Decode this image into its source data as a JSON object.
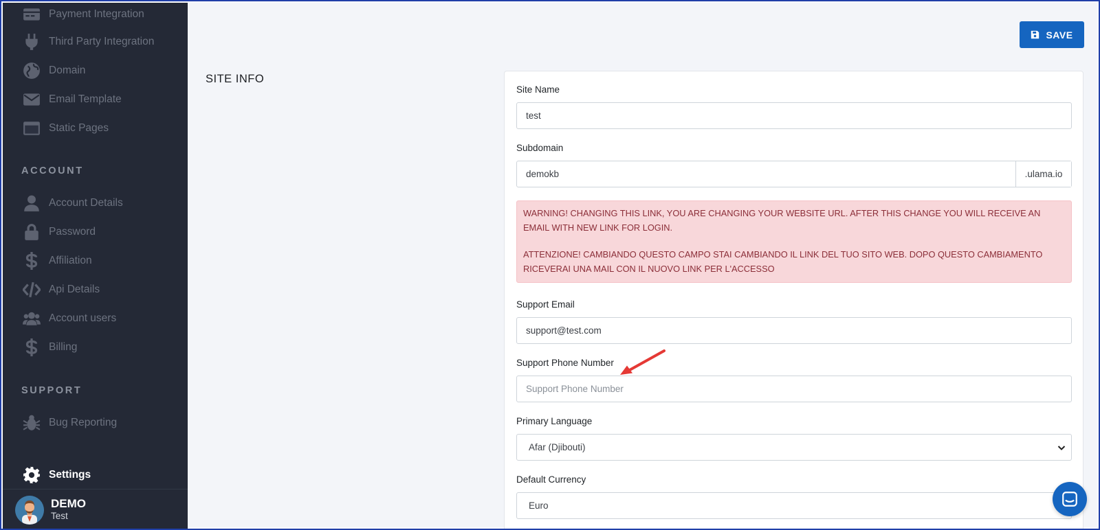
{
  "sidebar": {
    "items_top": [
      {
        "label": "Payment Integration",
        "icon": "payment-icon"
      },
      {
        "label": "Third Party Integration",
        "icon": "plug-icon"
      },
      {
        "label": "Domain",
        "icon": "globe-icon"
      },
      {
        "label": "Email Template",
        "icon": "envelope-icon"
      },
      {
        "label": "Static Pages",
        "icon": "window-icon"
      }
    ],
    "account_title": "ACCOUNT",
    "account_items": [
      {
        "label": "Account Details",
        "icon": "user-icon"
      },
      {
        "label": "Password",
        "icon": "lock-icon"
      },
      {
        "label": "Affiliation",
        "icon": "dollar-icon"
      },
      {
        "label": "Api Details",
        "icon": "code-icon"
      },
      {
        "label": "Account users",
        "icon": "users-icon"
      },
      {
        "label": "Billing",
        "icon": "dollar-icon"
      }
    ],
    "support_title": "SUPPORT",
    "support_items": [
      {
        "label": "Bug Reporting",
        "icon": "bug-icon"
      }
    ],
    "settings_label": "Settings",
    "user": {
      "name": "DEMO",
      "sub": "Test"
    }
  },
  "toolbar": {
    "save_label": "SAVE"
  },
  "section": {
    "title": "SITE INFO"
  },
  "form": {
    "site_name": {
      "label": "Site Name",
      "value": "test"
    },
    "subdomain": {
      "label": "Subdomain",
      "value": "demokb",
      "suffix": ".ulama.io"
    },
    "warning": {
      "en": "WARNING! CHANGING THIS LINK, YOU ARE CHANGING YOUR WEBSITE URL. AFTER THIS CHANGE YOU WILL RECEIVE AN EMAIL WITH NEW LINK FOR LOGIN.",
      "it": "ATTENZIONE! CAMBIANDO QUESTO CAMPO STAI CAMBIANDO IL LINK DEL TUO SITO WEB. DOPO QUESTO CAMBIAMENTO RICEVERAI UNA MAIL CON IL NUOVO LINK PER L'ACCESSO"
    },
    "support_email": {
      "label": "Support Email",
      "value": "support@test.com"
    },
    "support_phone": {
      "label": "Support Phone Number",
      "placeholder": "Support Phone Number"
    },
    "primary_language": {
      "label": "Primary Language",
      "value": "Afar (Djibouti)"
    },
    "default_currency": {
      "label": "Default Currency",
      "value": "Euro"
    }
  },
  "colors": {
    "accent": "#1565c0",
    "sidebar_bg": "#242936",
    "alert_bg": "#f8d7da",
    "annotation_arrow": "#e53935"
  }
}
